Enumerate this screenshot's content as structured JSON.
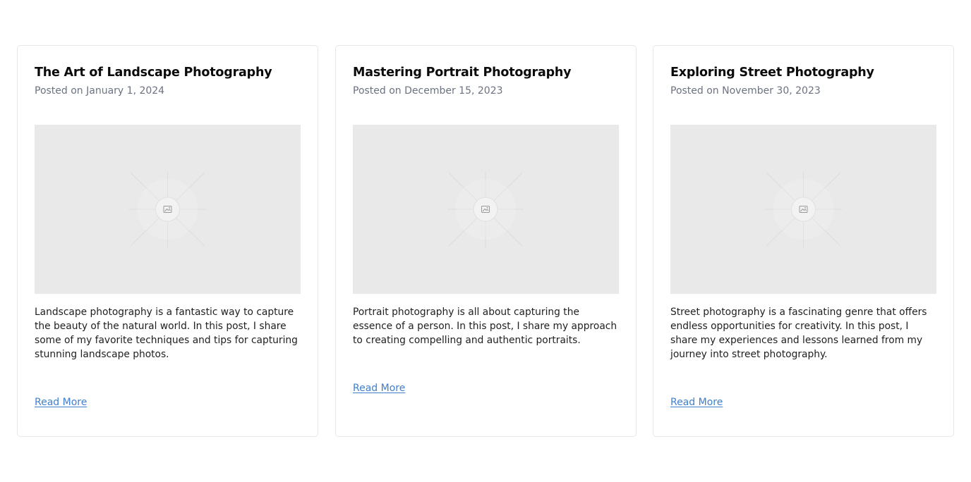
{
  "posts": [
    {
      "title": "The Art of Landscape Photography",
      "date": "Posted on January 1, 2024",
      "excerpt": "Landscape photography is a fantastic way to capture the beauty of the natural world. In this post, I share some of my favorite techniques and tips for capturing stunning landscape photos.",
      "link_label": "Read More",
      "image_icon": "image-placeholder-icon"
    },
    {
      "title": "Mastering Portrait Photography",
      "date": "Posted on December 15, 2023",
      "excerpt": "Portrait photography is all about capturing the essence of a person. In this post, I share my approach to creating compelling and authentic portraits.",
      "link_label": "Read More",
      "image_icon": "image-placeholder-icon"
    },
    {
      "title": "Exploring Street Photography",
      "date": "Posted on November 30, 2023",
      "excerpt": "Street photography is a fascinating genre that offers endless opportunities for creativity. In this post, I share my experiences and lessons learned from my journey into street photography.",
      "link_label": "Read More",
      "image_icon": "image-placeholder-icon"
    }
  ],
  "colors": {
    "link": "#3f7fd0",
    "date": "#6b7280",
    "placeholder_bg": "#e9e9e9",
    "card_border": "#e5e7eb"
  }
}
